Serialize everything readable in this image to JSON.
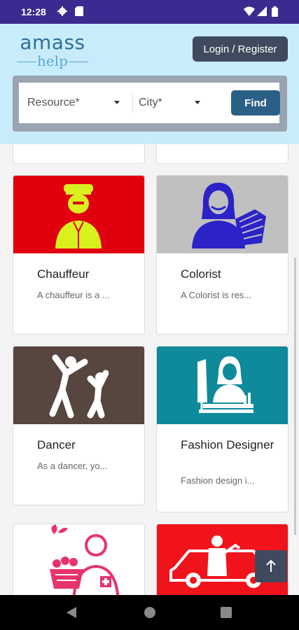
{
  "status_bar": {
    "time": "12:28"
  },
  "header": {
    "logo_top": "amass",
    "logo_bottom": "help",
    "login_label": "Login / Register"
  },
  "search": {
    "resource_label": "Resource*",
    "city_label": "City*",
    "find_label": "Find"
  },
  "cards": [
    {
      "title": "Chauffeur",
      "desc": "A chauffeur is a ...",
      "icon": "chauffeur-icon",
      "bg": "#e0000e"
    },
    {
      "title": "Colorist",
      "desc": "A Colorist is res...",
      "icon": "colorist-icon",
      "bg": "#c0c0c0"
    },
    {
      "title": "Dancer",
      "desc": "As a dancer, yo...",
      "icon": "dancer-icon",
      "bg": "#56463f"
    },
    {
      "title": "Fashion Designer",
      "desc": "Fashion design i...",
      "icon": "fashion-designer-icon",
      "bg": "#0e8a9a"
    },
    {
      "title": "",
      "desc": "",
      "icon": "gardener-icon",
      "bg": "#ffffff"
    },
    {
      "title": "",
      "desc": "",
      "icon": "mechanic-icon",
      "bg": "#f0131b"
    }
  ]
}
